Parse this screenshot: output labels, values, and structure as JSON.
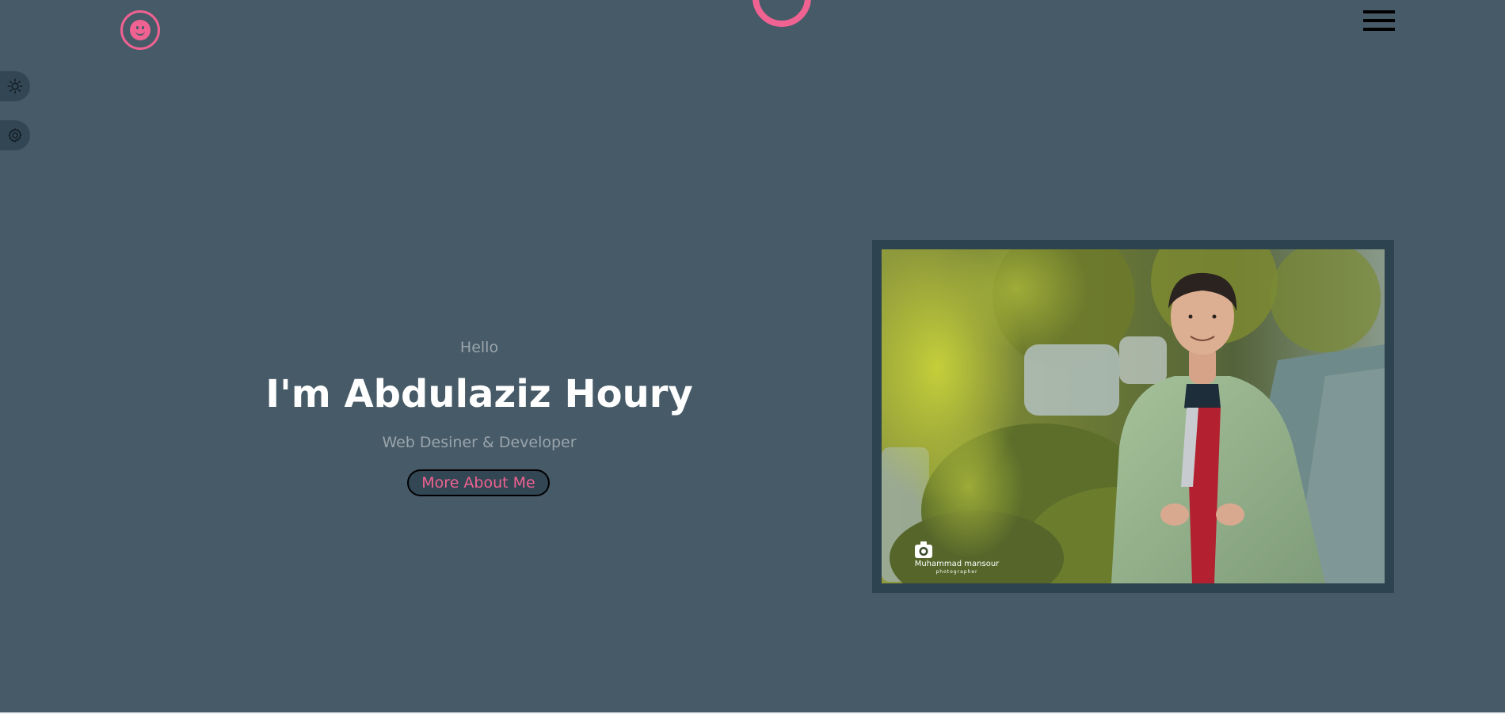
{
  "header": {
    "logo_icon": "smiley-face-icon",
    "loader_icon": "ring-loader-icon",
    "menu_icon": "hamburger-menu-icon"
  },
  "side_tools": {
    "theme_icon": "sun-icon",
    "settings_icon": "gear-icon"
  },
  "hero": {
    "greeting": "Hello",
    "name": "I'm Abdulaziz Houry",
    "role": "Web Desiner & Developer",
    "cta_label": "More About Me"
  },
  "portrait": {
    "watermark_name": "Muhammad mansour",
    "watermark_role": "photographer",
    "watermark_icon": "camera-icon"
  },
  "colors": {
    "background": "#475a67",
    "accent": "#f06292",
    "dark_panel": "#324653",
    "heading_text": "#ffffff",
    "muted_text": "#9aa4ab"
  }
}
